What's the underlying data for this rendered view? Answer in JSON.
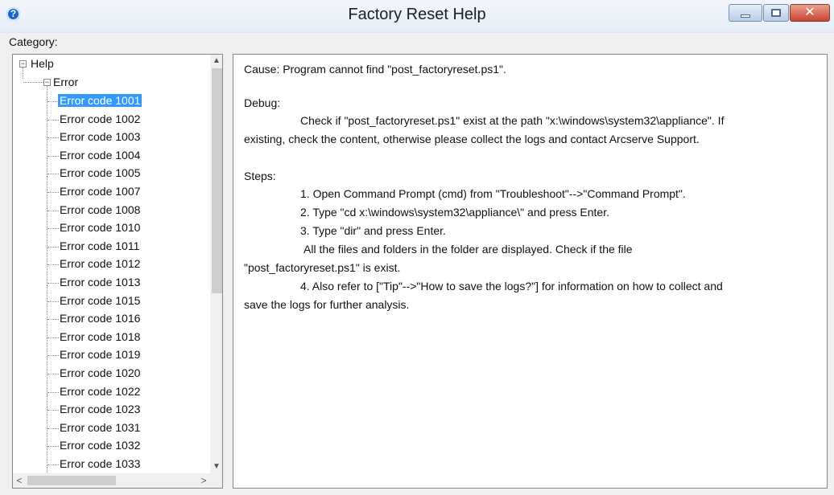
{
  "window": {
    "title": "Factory Reset Help",
    "help_icon_glyph": "?",
    "close_glyph": "✕"
  },
  "category_label": "Category:",
  "tree": {
    "root_label": "Help",
    "child_label": "Error",
    "selected": "Error code 1001",
    "items": [
      "Error code 1001",
      "Error code 1002",
      "Error code 1003",
      "Error code 1004",
      "Error code 1005",
      "Error code 1007",
      "Error code 1008",
      "Error code 1010",
      "Error code 1011",
      "Error code 1012",
      "Error code 1013",
      "Error code 1015",
      "Error code 1016",
      "Error code 1018",
      "Error code 1019",
      "Error code 1020",
      "Error code 1022",
      "Error code 1023",
      "Error code 1031",
      "Error code 1032",
      "Error code 1033"
    ]
  },
  "scrollbars": {
    "up": "▲",
    "down": "▼",
    "left": "<",
    "right": ">"
  },
  "content": {
    "cause": "Cause:    Program cannot find \"post_factoryreset.ps1\".",
    "debug_heading": "Debug:",
    "debug_line1": "Check if \"post_factoryreset.ps1\" exist at the path \"x:\\windows\\system32\\appliance\". If",
    "debug_line2": "existing, check the content, otherwise please collect the logs and contact Arcserve Support.",
    "steps_heading": "Steps:",
    "step1": "1. Open Command Prompt (cmd) from \"Troubleshoot\"-->\"Command Prompt\".",
    "step2": "2. Type \"cd x:\\windows\\system32\\appliance\\\" and press Enter.",
    "step3": "3. Type \"dir\" and press Enter.",
    "step3_note": "All the files and folders in the folder are displayed. Check if the file",
    "step3_note2": "\"post_factoryreset.ps1\" is exist.",
    "step4": "4. Also refer to [\"Tip\"-->\"How to save the logs?\"] for information on how to collect and",
    "step4_cont": "save the logs for further analysis."
  }
}
